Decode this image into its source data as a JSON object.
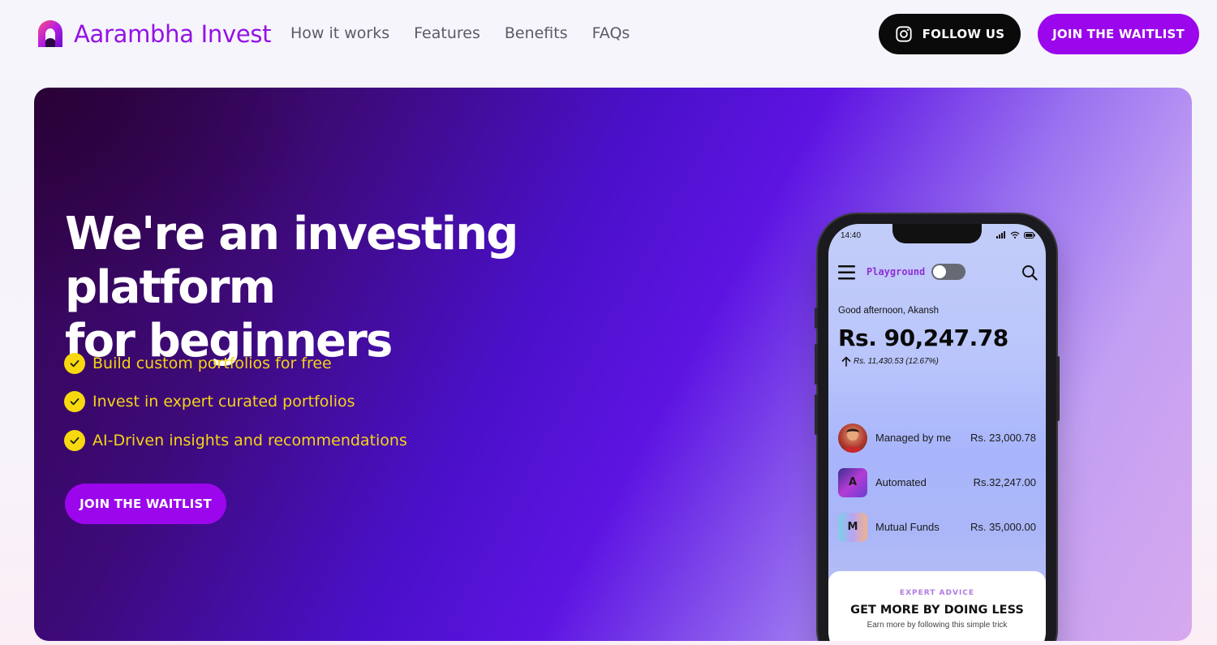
{
  "brand": {
    "name": "Aarambha Invest",
    "color": "#9411e6"
  },
  "nav": {
    "items": [
      "How it works",
      "Features",
      "Benefits",
      "FAQs"
    ]
  },
  "header": {
    "follow_label": "FOLLOW US",
    "waitlist_label": "JOIN THE WAITLIST"
  },
  "hero": {
    "title_line1": "We're an investing platform",
    "title_line2": "for beginners",
    "features": [
      "Build custom portfolios for free",
      "Invest in expert curated portfolios",
      "AI-Driven insights and recommendations"
    ],
    "cta_label": "JOIN THE WAITLIST",
    "accent_color": "#f5d416"
  },
  "phone": {
    "time": "14:40",
    "playground_label": "Playground",
    "greeting": "Good afternoon, Akansh",
    "balance": "Rs. 90,247.78",
    "gain": "Rs. 11,430.53 (12.67%)",
    "rows": [
      {
        "icon": "avatar",
        "label": "Managed by me",
        "value": "Rs. 23,000.78"
      },
      {
        "icon": "A",
        "label": "Automated",
        "value": "Rs.32,247.00"
      },
      {
        "icon": "M",
        "label": "Mutual Funds",
        "value": "Rs. 35,000.00"
      }
    ],
    "advice": {
      "tag": "EXPERT ADVICE",
      "title": "GET MORE BY DOING LESS",
      "subtitle": "Earn more by following this simple trick"
    }
  }
}
